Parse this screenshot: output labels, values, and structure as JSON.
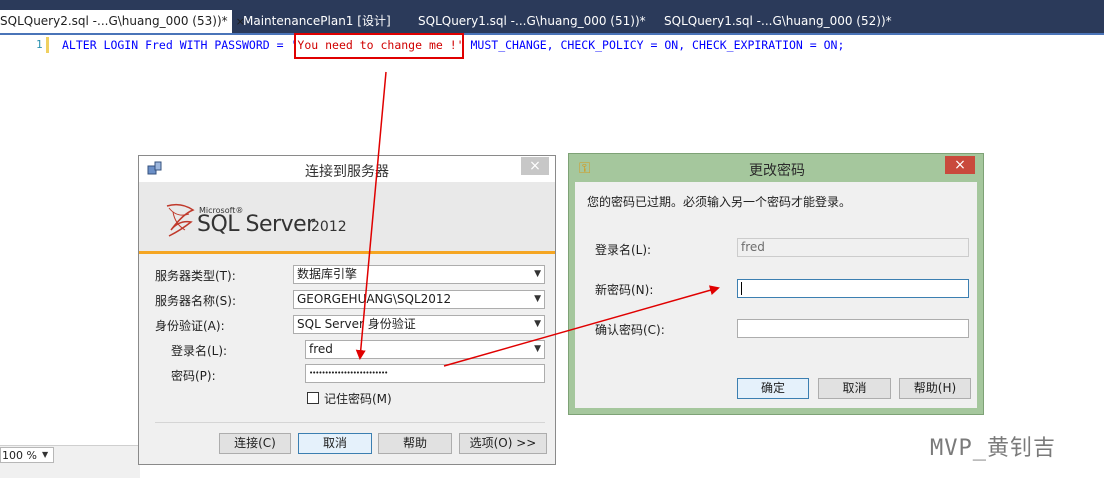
{
  "tabs": [
    {
      "label": "SQLQuery2.sql -...G\\huang_000 (53))*",
      "close": "×"
    },
    {
      "label": "MaintenancePlan1 [设计]"
    },
    {
      "label": "SQLQuery1.sql -...G\\huang_000 (51))*"
    },
    {
      "label": "SQLQuery1.sql -...G\\huang_000 (52))*"
    }
  ],
  "editor": {
    "line_number": "1",
    "code_before": "ALTER LOGIN Fred WITH PASSWORD = '",
    "code_string": "You need to change me !'",
    "code_after": " MUST_CHANGE, CHECK_POLICY = ON, CHECK_EXPIRATION = ON;",
    "zoom": "100 %"
  },
  "connect_dialog": {
    "title": "连接到服务器",
    "close": "×",
    "brand": {
      "company": "Microsoft®",
      "product": "SQL Server",
      "version": "2012"
    },
    "fields": {
      "server_type_label": "服务器类型(T):",
      "server_type_value": "数据库引擎",
      "server_name_label": "服务器名称(S):",
      "server_name_value": "GEORGEHUANG\\SQL2012",
      "auth_label": "身份验证(A):",
      "auth_value": "SQL Server 身份验证",
      "login_label": "登录名(L):",
      "login_value": "fred",
      "password_label": "密码(P):",
      "password_value": "•••••••••••••••••••••••••",
      "remember_label": "记住密码(M)"
    },
    "buttons": {
      "connect": "连接(C)",
      "cancel": "取消",
      "help": "帮助",
      "options": "选项(O) >>"
    }
  },
  "password_dialog": {
    "title": "更改密码",
    "close": "×",
    "message": "您的密码已过期。必须输入另一个密码才能登录。",
    "login_label": "登录名(L):",
    "login_value": "fred",
    "new_password_label": "新密码(N):",
    "confirm_password_label": "确认密码(C):",
    "buttons": {
      "ok": "确定",
      "cancel": "取消",
      "help": "帮助(H)"
    }
  },
  "watermark": "MVP_黄钊吉",
  "colors": {
    "annotation_red": "#e00000",
    "tab_bar": "#2b3a5a",
    "pwd_frame": "#a5c79d"
  }
}
